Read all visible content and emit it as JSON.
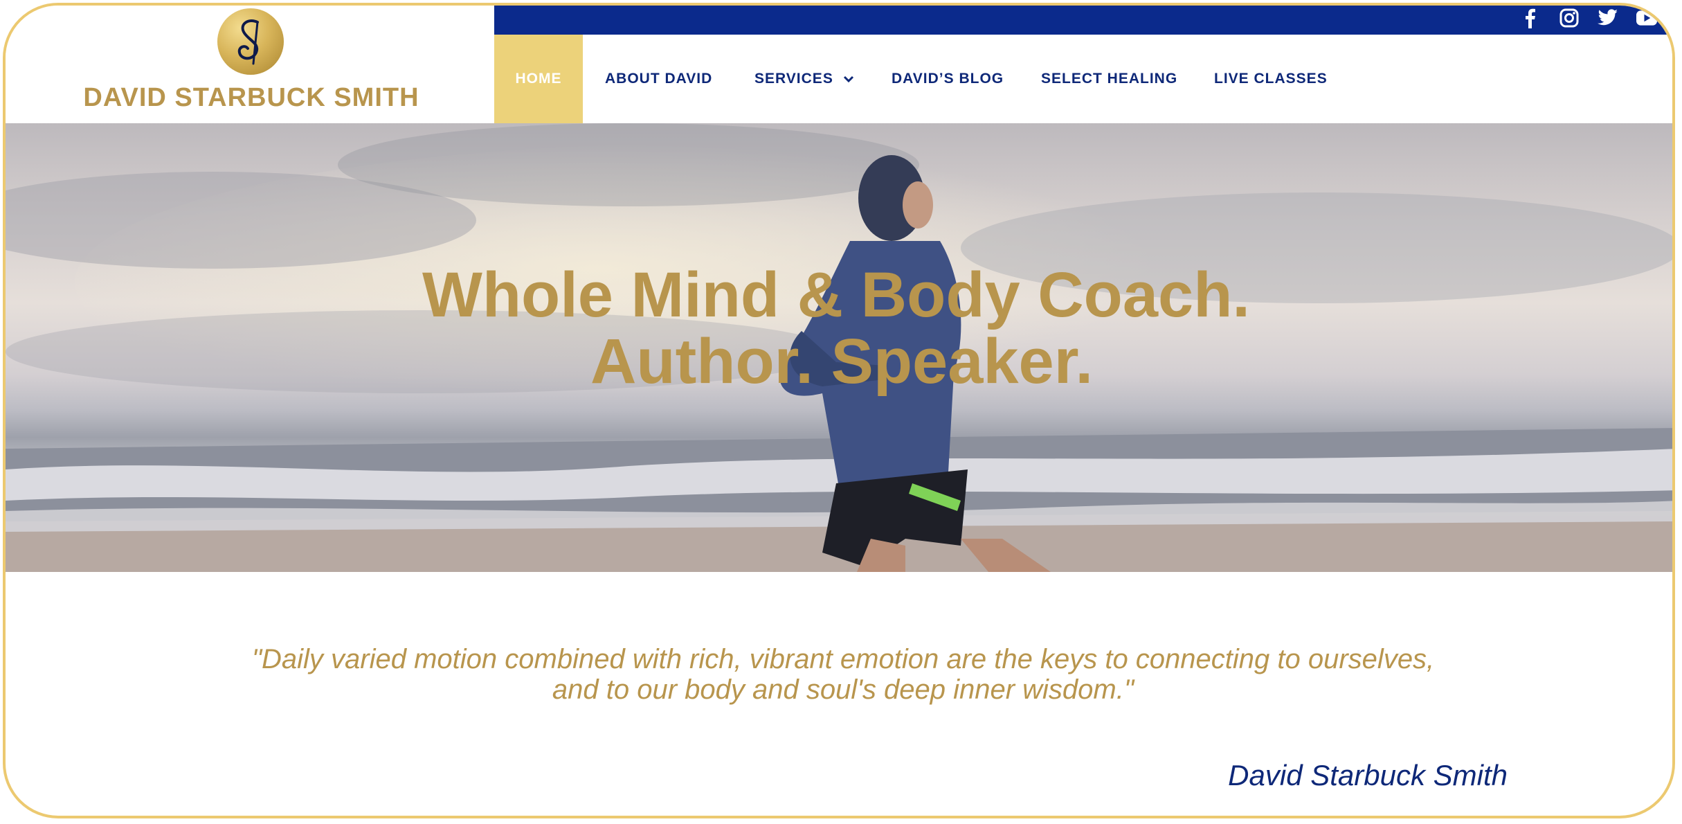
{
  "brand": {
    "name": "DAVID STARBUCK SMITH",
    "logo_letter": "S",
    "gold": "#b8954d",
    "navy": "#0e2878"
  },
  "social": [
    "facebook-icon",
    "instagram-icon",
    "twitter-icon",
    "youtube-icon"
  ],
  "nav": {
    "home": "HOME",
    "about": "ABOUT DAVID",
    "services": "SERVICES",
    "blog": "DAVID’S BLOG",
    "healing": "SELECT HEALING",
    "classes": "LIVE CLASSES"
  },
  "hero": {
    "line1": "Whole Mind & Body Coach.",
    "line2": "Author. Speaker."
  },
  "quote": {
    "line1": "\"Daily varied motion combined with rich, vibrant emotion are the keys to connecting to ourselves,",
    "line2": "and to our body and soul's deep inner wisdom.\"",
    "author": "David Starbuck Smith"
  }
}
